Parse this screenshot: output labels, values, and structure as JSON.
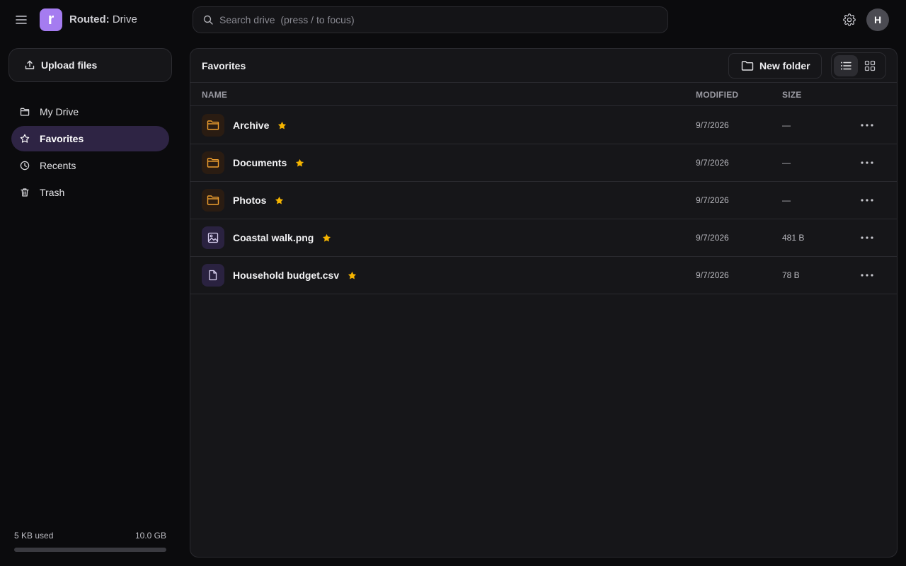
{
  "app": {
    "brand_bold": "Routed:",
    "brand_rest": " Drive",
    "logo_letter": "r",
    "accent_color": "#a57cf0"
  },
  "search": {
    "placeholder": "Search drive  (press / to focus)"
  },
  "user": {
    "avatar_initial": "H"
  },
  "sidebar": {
    "upload_label": "Upload files",
    "items": [
      {
        "label": "My Drive",
        "icon": "folder-icon",
        "active": false
      },
      {
        "label": "Favorites",
        "icon": "star-outline-icon",
        "active": true
      },
      {
        "label": "Recents",
        "icon": "clock-icon",
        "active": false
      },
      {
        "label": "Trash",
        "icon": "trash-icon",
        "active": false
      }
    ],
    "storage": {
      "used_label": "5 KB used",
      "total_label": "10.0 GB",
      "used_fraction": 0.0
    }
  },
  "main": {
    "title": "Favorites",
    "new_folder_label": "New folder",
    "view_mode": "list",
    "columns": {
      "name": "NAME",
      "modified": "MODIFIED",
      "size": "SIZE"
    },
    "files": [
      {
        "name": "Archive",
        "type": "folder",
        "modified": "9/7/2026",
        "size": "—",
        "starred": true
      },
      {
        "name": "Documents",
        "type": "folder",
        "modified": "9/7/2026",
        "size": "—",
        "starred": true
      },
      {
        "name": "Photos",
        "type": "folder",
        "modified": "9/7/2026",
        "size": "—",
        "starred": true
      },
      {
        "name": "Coastal walk.png",
        "type": "image",
        "modified": "9/7/2026",
        "size": "481 B",
        "starred": true
      },
      {
        "name": "Household budget.csv",
        "type": "doc",
        "modified": "9/7/2026",
        "size": "78 B",
        "starred": true
      }
    ]
  },
  "colors": {
    "folder_icon": "#f0a030",
    "star": "#f5b400",
    "active_nav_bg": "#2e2444"
  }
}
